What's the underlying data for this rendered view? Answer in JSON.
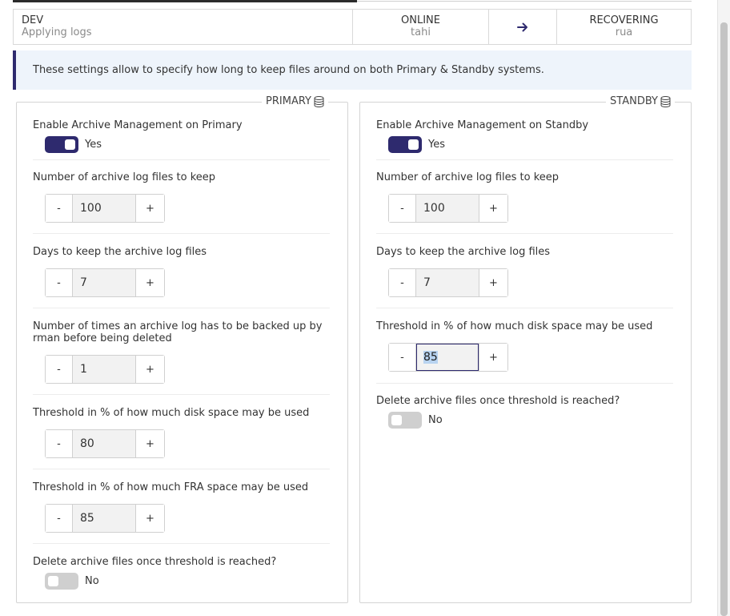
{
  "status": {
    "db_name": "DEV",
    "db_state": "Applying logs",
    "primary_status": "ONLINE",
    "primary_host": "tahi",
    "standby_status": "RECOVERING",
    "standby_host": "rua"
  },
  "info": "These settings allow to specify how long to keep files around on both Primary & Standby systems.",
  "primary": {
    "legend": "PRIMARY",
    "enable_label": "Enable Archive Management on Primary",
    "enable_state": "Yes",
    "archive_count_label": "Number of archive log files to keep",
    "archive_count_value": "100",
    "days_label": "Days to keep the archive log files",
    "days_value": "7",
    "backup_label": "Number of times an archive log has to be backed up by rman before being deleted",
    "backup_value": "1",
    "disk_label": "Threshold in % of how much disk space may be used",
    "disk_value": "80",
    "fra_label": "Threshold in % of how much FRA space may be used",
    "fra_value": "85",
    "delete_label": "Delete archive files once threshold is reached?",
    "delete_state": "No"
  },
  "standby": {
    "legend": "STANDBY",
    "enable_label": "Enable Archive Management on Standby",
    "enable_state": "Yes",
    "archive_count_label": "Number of archive log files to keep",
    "archive_count_value": "100",
    "days_label": "Days to keep the archive log files",
    "days_value": "7",
    "disk_label": "Threshold in % of how much disk space may be used",
    "disk_value": "85",
    "delete_label": "Delete archive files once threshold is reached?",
    "delete_state": "No"
  },
  "stepper": {
    "minus": "-",
    "plus": "+"
  },
  "icons": {
    "arrow": "arrow-right-icon",
    "database": "database-icon"
  },
  "colors": {
    "accent": "#2e2a6e",
    "banner_bg": "#eef4fb",
    "toggle_off": "#cfcfcf"
  }
}
